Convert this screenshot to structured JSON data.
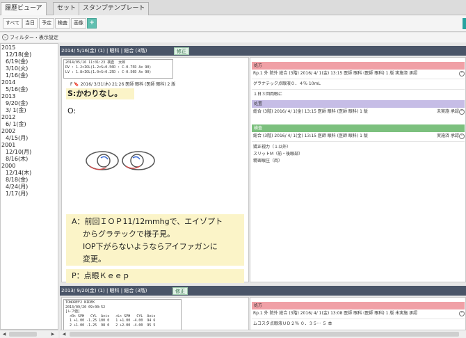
{
  "tabs": [
    {
      "label": "履歴ビューア",
      "active": true
    },
    {
      "label": "セット",
      "active": false
    },
    {
      "label": "スタンプテンプレート",
      "active": false
    }
  ],
  "toolbar": {
    "buttons": [
      "すべて",
      "当日",
      "予定",
      "検査",
      "画像"
    ],
    "add_label": "+"
  },
  "filter": {
    "toggle": "⌄",
    "label": "フィルター・表示設定"
  },
  "tree": {
    "items": [
      {
        "type": "year",
        "text": "2015"
      },
      {
        "type": "day",
        "text": "12/18(金)"
      },
      {
        "type": "day",
        "text": "6/19(金)"
      },
      {
        "type": "day",
        "text": "3/10(火)"
      },
      {
        "type": "day",
        "text": "1/16(金)"
      },
      {
        "type": "year",
        "text": "2014"
      },
      {
        "type": "day",
        "text": "5/16(金)"
      },
      {
        "type": "year",
        "text": "2013"
      },
      {
        "type": "day",
        "text": "9/20(金)"
      },
      {
        "type": "day",
        "text": "3/ 1(金)"
      },
      {
        "type": "year",
        "text": "2012"
      },
      {
        "type": "day",
        "text": "6/ 1(金)"
      },
      {
        "type": "year",
        "text": "2002"
      },
      {
        "type": "day",
        "text": "4/15(月)"
      },
      {
        "type": "year",
        "text": "2001"
      },
      {
        "type": "day",
        "text": "12/10(月)"
      },
      {
        "type": "day",
        "text": "8/16(木)"
      },
      {
        "type": "year",
        "text": "2000"
      },
      {
        "type": "day",
        "text": "12/14(木)"
      },
      {
        "type": "day",
        "text": "8/18(金)"
      },
      {
        "type": "day",
        "text": "4/24(月)"
      },
      {
        "type": "day",
        "text": "1/17(月)"
      }
    ],
    "scroll_left": "◀",
    "scroll_right": "▶"
  },
  "encounter1": {
    "header": "2014/ 5/16(金) (1)  |  眼科  |  総合 (3階)",
    "fix_label": "修正",
    "ref_text": "2014/05/16 11:01:23 検査  太郎\nRV : 1.2×IOL(1.2×S+0.50D : C-0.75D Ax 90)\nLV : 1.8×IOL(1.0×S+0.25D : C-0.50D Ax 90)",
    "entry_line": "F  🔖 2016/ 3/31(木) 21:26 医師 眼科 (医師 眼科) 2 版",
    "s_line": "S:かわりなし。",
    "o_label": "O:",
    "a_lines": [
      "A：前回ＩＯＰ11/12mmhgで、エイゾプト",
      "からグラテックで様子見。",
      "IOP下がらないようならアイファガンに",
      "変更。"
    ],
    "p_line": "P：点眼Ｋｅｅｐ",
    "prescription": {
      "header": "処方",
      "rp_line": "Rp.1  外  院外  総合 (3階) 2016/ 4/ 1(金) 13:15  医師  眼科 (医師  眼科) 1 版  実施済  承認",
      "drug": "グラナテック点眼液０．４％   10ｍL",
      "usage": "１日３回両眼に"
    },
    "procedure": {
      "header": "処置",
      "line": "総合 (3階) 2016/ 4/ 1(金) 13:15  医師  眼科 (医師  眼科) 1 版",
      "status": "未実施  承認"
    },
    "exam": {
      "header": "検査",
      "line": "総合 (3階) 2016/ 4/ 1(金) 13:15  医師  眼科 (医師  眼科) 1 版",
      "status": "実施済  承認",
      "items": [
        "矯正視力（１以外）",
        "スリットM（前・後眼部）",
        "精密眼圧（両）"
      ]
    }
  },
  "encounter2": {
    "header": "2013/ 9/20(金) (1)  |  眼科  |  総合 (3階)",
    "fix_label": "修正",
    "ref_text": "TONOREF2 NIDEK\n2013/09/20 09:00:52\n[レフ値]\n  <R> SPH   CYL  Axis   <L> SPH   CYL  Axis\n  1 +1.00 -1.25 100 0   1 +1.00 -4.00  94 6\n  2 +1.00 -1.25  98 0   2 +2.00 -4.00  95 5",
    "prescription": {
      "header": "処方",
      "rp_line": "Rp.1  外  院外  総合 (3階) 2016/ 4/ 1(金) 13:08  医師  眼科 (医師  眼科) 1 版  未実施  承認",
      "drug": "ムコスタ点眼液ＵＤ２％  ０．３５···  ５ 本"
    }
  },
  "toggle_icon": "⌃",
  "colors": {
    "encounter_bar": "#4a5568",
    "note_highlight": "#fbf4c8",
    "prescription_header": "#f0a0a6",
    "procedure_header": "#c6bde6",
    "exam_header": "#7cc07e",
    "accent": "#27a3a0"
  }
}
